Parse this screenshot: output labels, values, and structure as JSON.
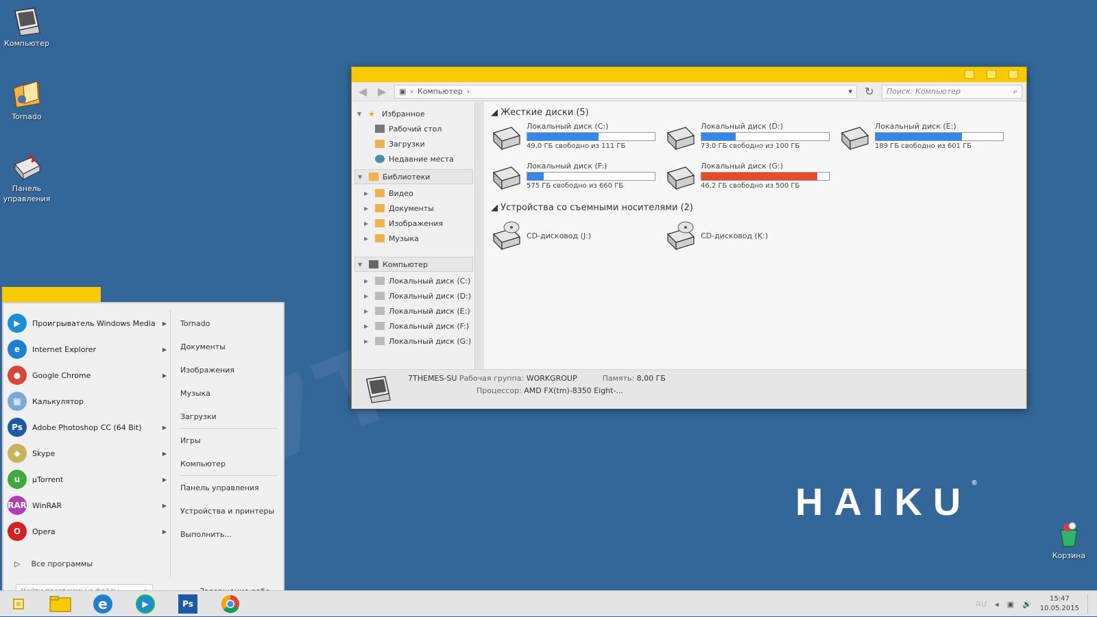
{
  "desktop": {
    "icons": [
      {
        "label": "Компьютер"
      },
      {
        "label": "Tornado"
      },
      {
        "label": "Панель управления"
      },
      {
        "label": "Корзина"
      }
    ],
    "logo_text": "HAIKU",
    "logo_mark": "®",
    "watermark": "7THEMES.SU"
  },
  "explorer": {
    "address": "Компьютер",
    "search_placeholder": "Поиск: Компьютер",
    "nav": {
      "favorites": "Избранное",
      "favorites_items": [
        "Рабочий стол",
        "Загрузки",
        "Недавние места"
      ],
      "libraries": "Библиотеки",
      "libraries_items": [
        "Видео",
        "Документы",
        "Изображения",
        "Музыка"
      ],
      "computer": "Компьютер",
      "computer_items": [
        "Локальный диск (C:)",
        "Локальный диск (D:)",
        "Локальный диск (E:)",
        "Локальный диск (F:)",
        "Локальный диск (G:)"
      ]
    },
    "hard_disks_header": "Жесткие диски (5)",
    "drives": [
      {
        "name": "Локальный диск (C:)",
        "free": "49,0 ГБ свободно из 111 ГБ",
        "used_pct": 56,
        "color": "#3388ee"
      },
      {
        "name": "Локальный диск (D:)",
        "free": "73,0 ГБ свободно из 100 ГБ",
        "used_pct": 27,
        "color": "#3388ee"
      },
      {
        "name": "Локальный диск (E:)",
        "free": "189 ГБ свободно из 601 ГБ",
        "used_pct": 68,
        "color": "#3388ee"
      },
      {
        "name": "Локальный диск (F:)",
        "free": "575 ГБ свободно из 660 ГБ",
        "used_pct": 13,
        "color": "#3388ee"
      },
      {
        "name": "Локальный диск (G:)",
        "free": "46,2 ГБ свободно из 500 ГБ",
        "used_pct": 91,
        "color": "#ea4a2a"
      }
    ],
    "removable_header": "Устройства со съемными носителями (2)",
    "removable": [
      "CD-дисковод (J:)",
      "CD-дисковод (K:)"
    ],
    "details": {
      "computer_name": "7THEMES-SU",
      "workgroup_label": "Рабочая группа:",
      "workgroup": "WORKGROUP",
      "memory_label": "Память:",
      "memory": "8,00 ГБ",
      "cpu_label": "Процессор:",
      "cpu": "AMD FX(tm)-8350 Eight-..."
    }
  },
  "start_menu": {
    "programs": [
      {
        "label": "Проигрыватель Windows Media",
        "icon": "media-player-icon",
        "color": "#1a8fd6",
        "glyph": "▶"
      },
      {
        "label": "Internet Explorer",
        "icon": "ie-icon",
        "color": "#1d7fcf",
        "glyph": "e"
      },
      {
        "label": "Google Chrome",
        "icon": "chrome-icon",
        "color": "#db4437",
        "glyph": "●"
      },
      {
        "label": "Калькулятор",
        "icon": "calculator-icon",
        "color": "#7aa8d8",
        "glyph": "▦"
      },
      {
        "label": "Adobe Photoshop CC (64 Bit)",
        "icon": "photoshop-icon",
        "color": "#1c5aa8",
        "glyph": "Ps"
      },
      {
        "label": "Skype",
        "icon": "skype-icon",
        "color": "#c8b25a",
        "glyph": "◆"
      },
      {
        "label": "µTorrent",
        "icon": "utorrent-icon",
        "color": "#3eaa3a",
        "glyph": "u"
      },
      {
        "label": "WinRAR",
        "icon": "winrar-icon",
        "color": "#b33bb8",
        "glyph": "RAR"
      },
      {
        "label": "Opera",
        "icon": "opera-icon",
        "color": "#d61f1f",
        "glyph": "O"
      }
    ],
    "all_programs": "Все программы",
    "search_placeholder": "Найти программы и файлы",
    "places": [
      "Tornado",
      "Документы",
      "Изображения",
      "Музыка",
      "Загрузки",
      "Игры",
      "Компьютер",
      "Панель управления",
      "Устройства и принтеры",
      "Выполнить..."
    ],
    "shutdown": "Завершение рабо..."
  },
  "taskbar": {
    "lang": "RU",
    "time": "15:47",
    "date": "10.05.2015"
  }
}
